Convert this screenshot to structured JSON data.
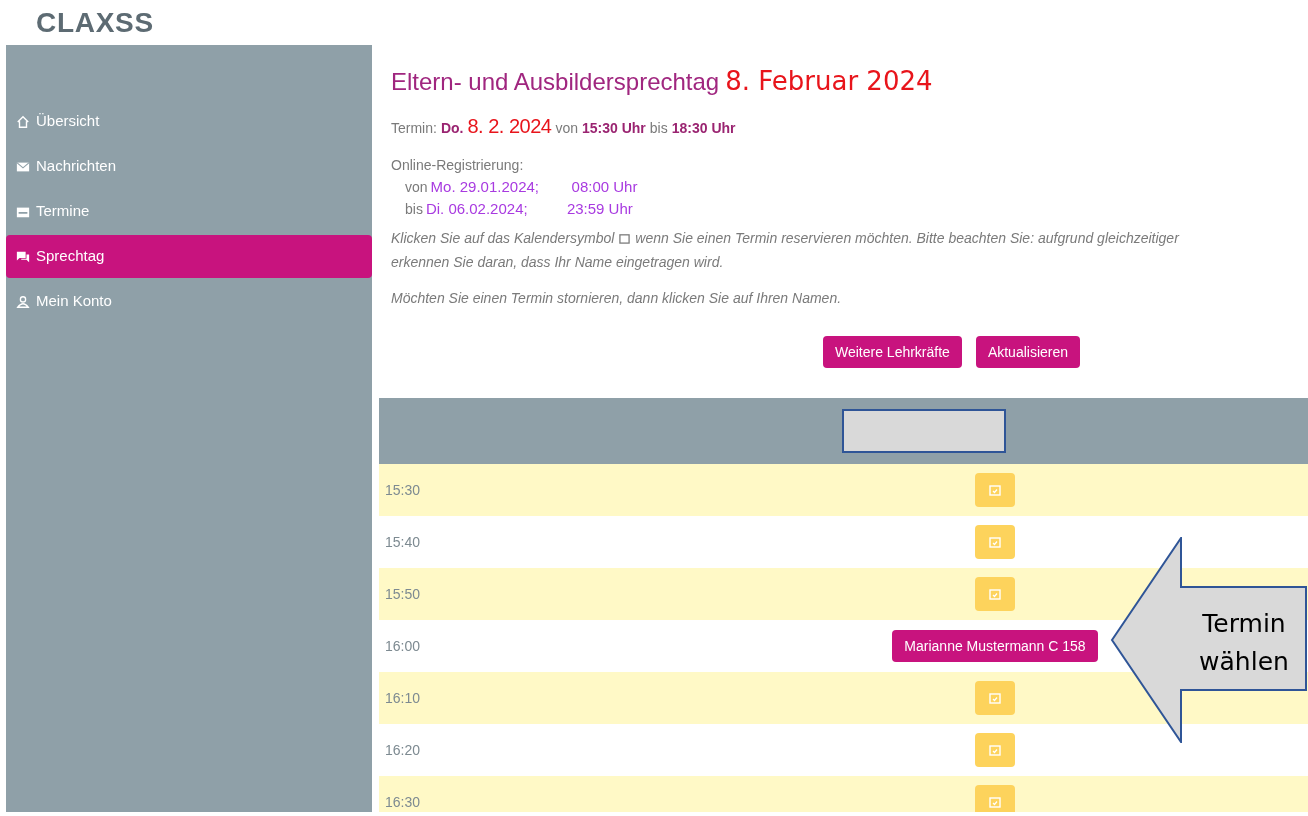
{
  "logo": {
    "text": "CLAXSS"
  },
  "sidebar": {
    "items": [
      {
        "label": "Übersicht",
        "kind": "home",
        "selected": false
      },
      {
        "label": "Nachrichten",
        "kind": "mail",
        "selected": false
      },
      {
        "label": "Termine",
        "kind": "calendar",
        "selected": false
      },
      {
        "label": "Sprechtag",
        "kind": "chat",
        "selected": true
      },
      {
        "label": "Mein Konto",
        "kind": "user",
        "selected": false
      }
    ]
  },
  "title": {
    "event": "Eltern- und Ausbildersprechtag",
    "date": "8. Februar 2024"
  },
  "termin": {
    "label": "Termin:",
    "day": "Do.",
    "date": "8. 2. 2024",
    "from_word": "von",
    "start": "15:30 Uhr",
    "to_word": "bis",
    "end": "18:30 Uhr"
  },
  "registration": {
    "label": "Online-Registrierung:",
    "lines": [
      {
        "word": "von",
        "date": "Mo. 29.01.2024;",
        "time": "08:00 Uhr"
      },
      {
        "word": "bis",
        "date": "Di. 06.02.2024;",
        "time": "23:59 Uhr"
      }
    ]
  },
  "hint": {
    "before": "Klicken Sie auf das Kalendersymbol",
    "after": "wenn Sie einen Termin reservieren möchten. Bitte beachten Sie: aufgrund gleichzeitiger",
    "line2": "erkennen Sie daran, dass Ihr Name eingetragen wird."
  },
  "cancel_hint": "Möchten Sie einen Termin stornieren, dann klicken Sie auf Ihren Namen.",
  "buttons": [
    "Weitere Lehrkräfte",
    "Aktualisieren"
  ],
  "slots": [
    {
      "time": "15:30",
      "kind": "free"
    },
    {
      "time": "15:40",
      "kind": "free"
    },
    {
      "time": "15:50",
      "kind": "free"
    },
    {
      "time": "16:00",
      "kind": "booked",
      "name": "Marianne Mustermann C 158"
    },
    {
      "time": "16:10",
      "kind": "free"
    },
    {
      "time": "16:20",
      "kind": "free"
    },
    {
      "time": "16:30",
      "kind": "free"
    }
  ],
  "callout": {
    "text": "Termin wählen"
  }
}
